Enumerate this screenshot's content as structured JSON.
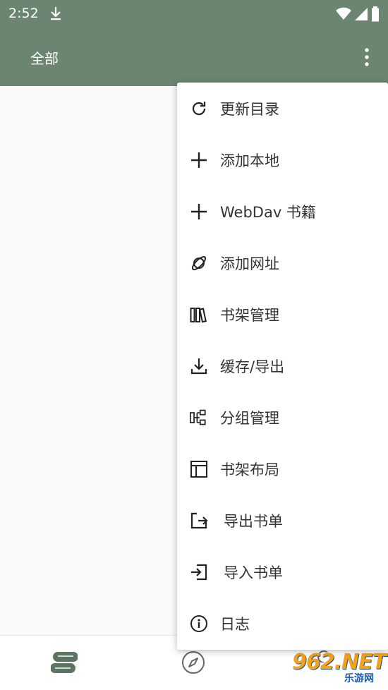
{
  "status_bar": {
    "time": "2:52",
    "icons": [
      "download-icon",
      "wifi-icon",
      "signal-icon",
      "battery-icon"
    ]
  },
  "toolbar": {
    "title": "全部",
    "overflow_icon": "more-vert-icon"
  },
  "menu": {
    "items": [
      {
        "label": "更新目录",
        "icon": "refresh-icon"
      },
      {
        "label": "添加本地",
        "icon": "add-icon"
      },
      {
        "label": "WebDav 书籍",
        "icon": "add-icon"
      },
      {
        "label": "添加网址",
        "icon": "planet-icon"
      },
      {
        "label": "书架管理",
        "icon": "books-icon"
      },
      {
        "label": "缓存/导出",
        "icon": "download-icon"
      },
      {
        "label": "分组管理",
        "icon": "group-icon"
      },
      {
        "label": "书架布局",
        "icon": "layout-icon"
      },
      {
        "label": "导出书单",
        "icon": "export-icon"
      },
      {
        "label": "导入书单",
        "icon": "import-icon"
      },
      {
        "label": "日志",
        "icon": "info-icon"
      }
    ]
  },
  "bottom_nav": {
    "items": [
      "bookshelf-icon",
      "explore-icon"
    ]
  },
  "watermark": {
    "main": "962.NET",
    "sub": "乐游网"
  },
  "colors": {
    "toolbar": "#6b8570",
    "menu_bg": "#ffffff",
    "text": "#333333"
  }
}
